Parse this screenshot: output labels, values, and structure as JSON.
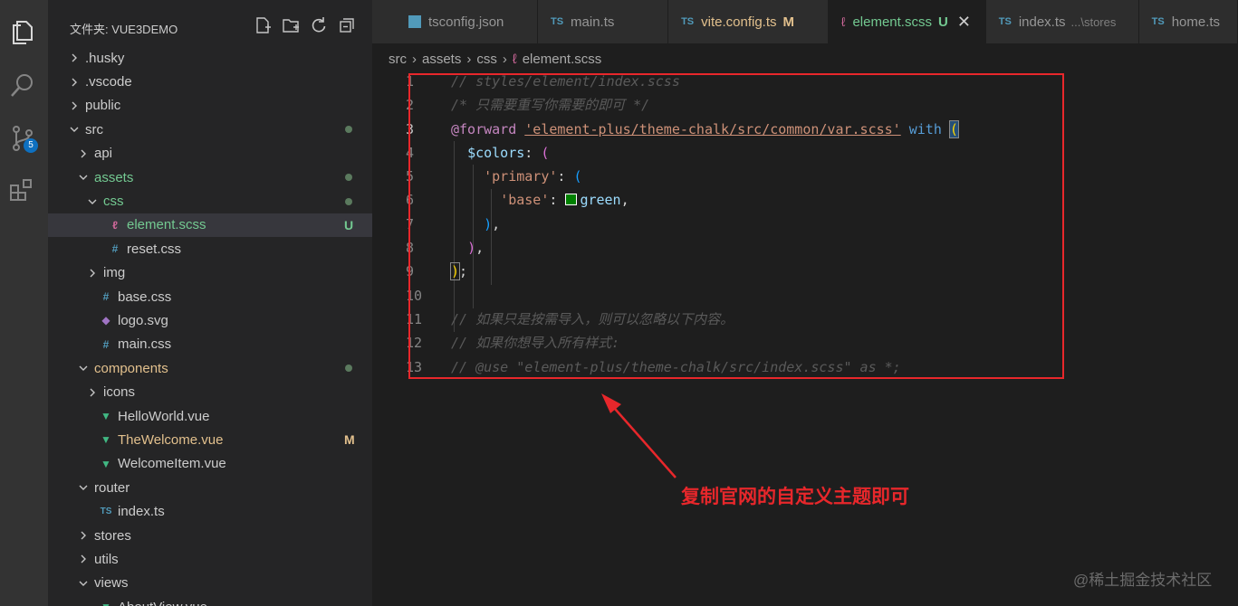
{
  "sidebar": {
    "title": "文件夹: VUE3DEMO",
    "tree": [
      {
        "label": ".husky",
        "indent": 0,
        "chevron": "right",
        "icon": "",
        "color": "default"
      },
      {
        "label": ".vscode",
        "indent": 0,
        "chevron": "right",
        "icon": "",
        "color": "default"
      },
      {
        "label": "public",
        "indent": 0,
        "chevron": "right",
        "icon": "",
        "color": "default"
      },
      {
        "label": "src",
        "indent": 0,
        "chevron": "down",
        "icon": "",
        "color": "default",
        "dot": true
      },
      {
        "label": "api",
        "indent": 1,
        "chevron": "right",
        "icon": "",
        "color": "default"
      },
      {
        "label": "assets",
        "indent": 1,
        "chevron": "down",
        "icon": "",
        "color": "green",
        "dot": true
      },
      {
        "label": "css",
        "indent": 2,
        "chevron": "down",
        "icon": "",
        "color": "green",
        "dot": true
      },
      {
        "label": "element.scss",
        "indent": 3,
        "chevron": "",
        "icon": "sass",
        "color": "green",
        "status": "U",
        "selected": true
      },
      {
        "label": "reset.css",
        "indent": 3,
        "chevron": "",
        "icon": "hash",
        "color": "default"
      },
      {
        "label": "img",
        "indent": 2,
        "chevron": "right",
        "icon": "",
        "color": "default"
      },
      {
        "label": "base.css",
        "indent": 2,
        "chevron": "",
        "icon": "hash",
        "color": "default"
      },
      {
        "label": "logo.svg",
        "indent": 2,
        "chevron": "",
        "icon": "svg",
        "color": "default"
      },
      {
        "label": "main.css",
        "indent": 2,
        "chevron": "",
        "icon": "hash",
        "color": "default"
      },
      {
        "label": "components",
        "indent": 1,
        "chevron": "down",
        "icon": "",
        "color": "yellow",
        "dot": true
      },
      {
        "label": "icons",
        "indent": 2,
        "chevron": "right",
        "icon": "",
        "color": "default"
      },
      {
        "label": "HelloWorld.vue",
        "indent": 2,
        "chevron": "",
        "icon": "vue",
        "color": "default"
      },
      {
        "label": "TheWelcome.vue",
        "indent": 2,
        "chevron": "",
        "icon": "vue",
        "color": "yellow",
        "status": "M"
      },
      {
        "label": "WelcomeItem.vue",
        "indent": 2,
        "chevron": "",
        "icon": "vue",
        "color": "default"
      },
      {
        "label": "router",
        "indent": 1,
        "chevron": "down",
        "icon": "",
        "color": "default"
      },
      {
        "label": "index.ts",
        "indent": 2,
        "chevron": "",
        "icon": "ts",
        "color": "default"
      },
      {
        "label": "stores",
        "indent": 1,
        "chevron": "right",
        "icon": "",
        "color": "default"
      },
      {
        "label": "utils",
        "indent": 1,
        "chevron": "right",
        "icon": "",
        "color": "default"
      },
      {
        "label": "views",
        "indent": 1,
        "chevron": "down",
        "icon": "",
        "color": "default"
      },
      {
        "label": "AboutView.vue",
        "indent": 2,
        "chevron": "",
        "icon": "vue",
        "color": "default"
      }
    ]
  },
  "activity": {
    "scm_badge": "5"
  },
  "tabs": [
    {
      "label": "tsconfig.json",
      "icon": "json",
      "modifier": "",
      "desc": "",
      "active": false
    },
    {
      "label": "main.ts",
      "icon": "ts",
      "modifier": "",
      "desc": "",
      "active": false
    },
    {
      "label": "vite.config.ts",
      "icon": "ts",
      "modifier": "M",
      "desc": "",
      "active": false
    },
    {
      "label": "element.scss",
      "icon": "sass",
      "modifier": "U",
      "desc": "",
      "active": true
    },
    {
      "label": "index.ts",
      "icon": "ts",
      "modifier": "",
      "desc": "...\\stores",
      "active": false
    },
    {
      "label": "home.ts",
      "icon": "ts",
      "modifier": "",
      "desc": "",
      "active": false
    }
  ],
  "breadcrumb": [
    "src",
    "assets",
    "css",
    "element.scss"
  ],
  "code": {
    "line_numbers": [
      "1",
      "2",
      "3",
      "4",
      "5",
      "6",
      "7",
      "8",
      "9",
      "10",
      "11",
      "12",
      "13"
    ],
    "l1": "// styles/element/index.scss",
    "l2": "/* 只需要重写你需要的即可 */",
    "l3_kw": "@forward",
    "l3_str": "'element-plus/theme-chalk/src/common/var.scss'",
    "l3_with": "with",
    "l3_paren": "(",
    "l4_var": "$colors",
    "l4_rest": ": ",
    "l4_paren": "(",
    "l5_str": "'primary'",
    "l5_rest": ": ",
    "l5_paren": "(",
    "l6_str": "'base'",
    "l6_rest": ": ",
    "l6_val": "green",
    "l6_end": ",",
    "l7_paren": ")",
    "l7_end": ",",
    "l8_paren": ")",
    "l8_end": ",",
    "l9_paren": ")",
    "l9_end": ";",
    "l11": "// 如果只是按需导入，则可以忽略以下内容。",
    "l12": "// 如果你想导入所有样式:",
    "l13": "// @use \"element-plus/theme-chalk/src/index.scss\" as *;"
  },
  "annotation": {
    "callout": "复制官网的自定义主题即可"
  },
  "watermark": "@稀土掘金技术社区"
}
